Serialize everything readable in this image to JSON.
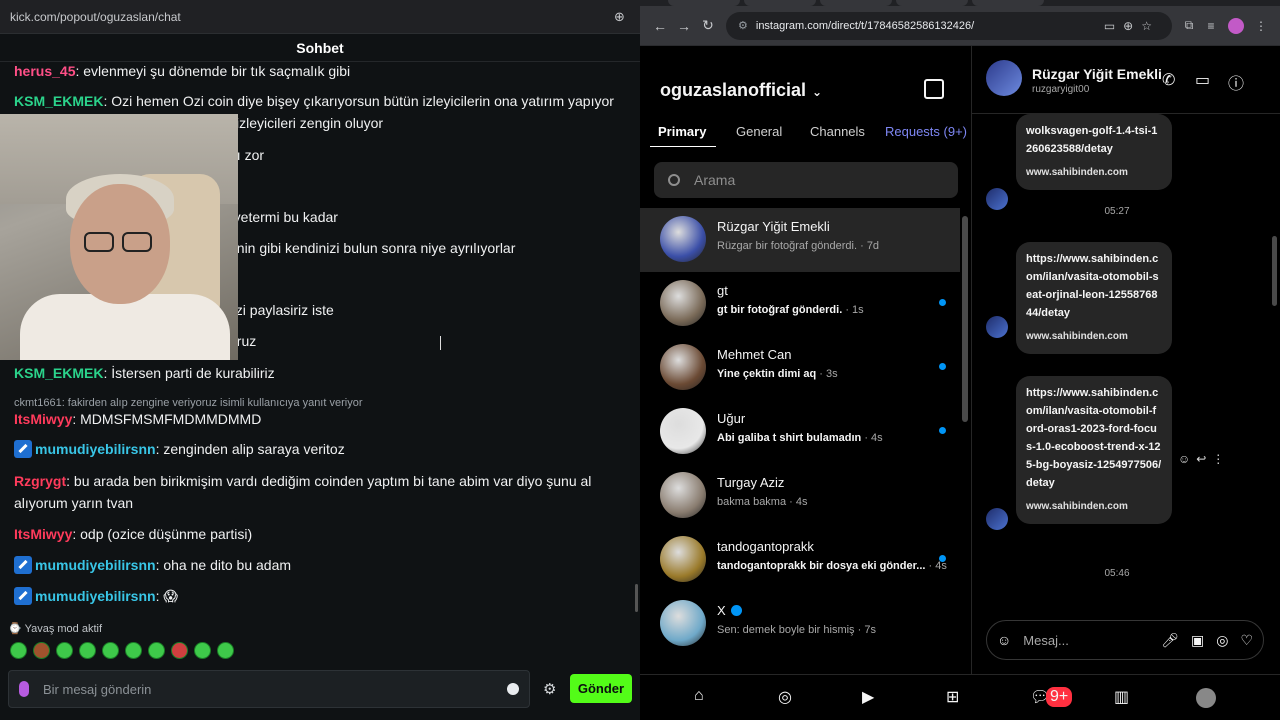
{
  "kick": {
    "url": "kick.com/popout/oguzaslan/chat",
    "header": "Sohbet",
    "messages": [
      {
        "user": "herus_45",
        "color": "#ff4f87",
        "text": "evlenmeyi şu dönemde bir tık saçmalık gibi"
      },
      {
        "user": "KSM_EKMEK",
        "color": "#2bd38b",
        "text": "Ozi hemen Ozi coin diye bişey çıkarıyorsun bütün izleyicilerin ona yatırım yapıyor"
      },
      {
        "user": "",
        "color": "#f0f1f2",
        "text": "zi izleyicileri zengin oluyor"
      },
      {
        "user": "",
        "color": "#f0f1f2",
        "text": "ası zor"
      },
      {
        "user": "",
        "color": "#f0f1f2",
        "text": "ıı yetermi bu kadar"
      },
      {
        "user": "",
        "color": "#f0f1f2",
        "text": "senin gibi kendinizi bulun sonra niye ayrılıyorlar"
      },
      {
        "user": "",
        "color": "#f0f1f2",
        "text": "ozi paylasiriz iste"
      },
      {
        "user": "",
        "color": "#f0f1f2",
        "text": "yoruz"
      },
      {
        "user": "KSM_EKMEK",
        "color": "#2bd38b",
        "text": "İstersen parti de kurabiliriz"
      },
      {
        "reply": "ckmt1661: fakirden alıp zengine veriyoruz isimli kullanıcıya yanıt veriyor"
      },
      {
        "user": "ItsMiwyy",
        "color": "#ff3b5c",
        "text": "MDMSFMSMFMDMMDMMD"
      },
      {
        "user": "mumudiyebilirsnn",
        "color": "#39c6e7",
        "text": "zenginden alip saraya veritoz",
        "badge": true
      },
      {
        "user": "Rzgrygt",
        "color": "#ff3b5c",
        "text": "bu arada ben birikmişim vardı dediğim coinden yaptım bi tane abim var diyo şunu al"
      },
      {
        "user": "",
        "color": "#f0f1f2",
        "text": "alıyorum yarın tvan"
      },
      {
        "user": "ItsMiwyy",
        "color": "#ff3b5c",
        "text": "odp (ozice düşünme partisi)"
      },
      {
        "user": "mumudiyebilirsnn",
        "color": "#39c6e7",
        "text": "oha ne dito bu adam",
        "badge": true
      },
      {
        "user": "mumudiyebilirsnn",
        "color": "#39c6e7",
        "text": "😱",
        "badge": true
      }
    ],
    "slow_mode": "Yavaş mod aktif",
    "input_placeholder": "Bir mesaj gönderin",
    "send_label": "Gönder",
    "accent": "#53fc18"
  },
  "chrome": {
    "url": "instagram.com/direct/t/17846582586132426/"
  },
  "ig": {
    "account": "oguzaslanofficial",
    "tabs": [
      "Primary",
      "General",
      "Channels",
      "Requests (9+)"
    ],
    "search_placeholder": "Arama",
    "conversations": [
      {
        "name": "Rüzgar Yiğit Emekli",
        "preview": "Rüzgar bir fotoğraf gönderdi.",
        "time": "· 7d",
        "unread": false,
        "selected": true,
        "color": "#3b4fa8"
      },
      {
        "name": "gt",
        "preview": "gt bir fotoğraf gönderdi.",
        "time": "· 1s",
        "unread": true,
        "selected": false,
        "color": "#7a6a58"
      },
      {
        "name": "Mehmet Can",
        "preview": "Yine çektin dimi aq",
        "time": "· 3s",
        "unread": true,
        "selected": false,
        "color": "#6b4a34"
      },
      {
        "name": "Uğur",
        "preview": "Abi galiba t shirt bulamadın",
        "time": "· 4s",
        "unread": true,
        "selected": false,
        "color": "#e8e8e8"
      },
      {
        "name": "Turgay Aziz",
        "preview": "bakma bakma",
        "time": "· 4s",
        "unread": false,
        "selected": false,
        "color": "#8a7d70"
      },
      {
        "name": "tandogantoprakk",
        "preview": "tandogantoprakk bir dosya eki gönder...",
        "time": "· 4s",
        "unread": true,
        "selected": false,
        "color": "#9a7a2a"
      },
      {
        "name": "X",
        "preview": "Sen: demek boyle bir hismiş",
        "time": "· 7s",
        "unread": false,
        "selected": false,
        "color": "#6fa9c9",
        "verified": true
      }
    ],
    "thread": {
      "name": "Rüzgar Yiğit Emekli",
      "username": "ruzgaryigit00",
      "messages": [
        {
          "text": "wolksvagen-golf-1.4-tsi-1260623588/detay",
          "site": "www.sahibinden.com"
        },
        {
          "time": "05:27"
        },
        {
          "text": "https://www.sahibinden.com/ilan/vasita-otomobil-seat-orjinal-leon-1255876844/detay",
          "site": "www.sahibinden.com"
        },
        {
          "text": "https://www.sahibinden.com/ilan/vasita-otomobil-ford-oras1-2023-ford-focus-1.0-ecoboost-trend-x-125-bg-boyasiz-1254977506/detay",
          "site": "www.sahibinden.com"
        },
        {
          "time": "05:46"
        }
      ],
      "composer_placeholder": "Mesaj..."
    },
    "notif_count": "9+"
  }
}
